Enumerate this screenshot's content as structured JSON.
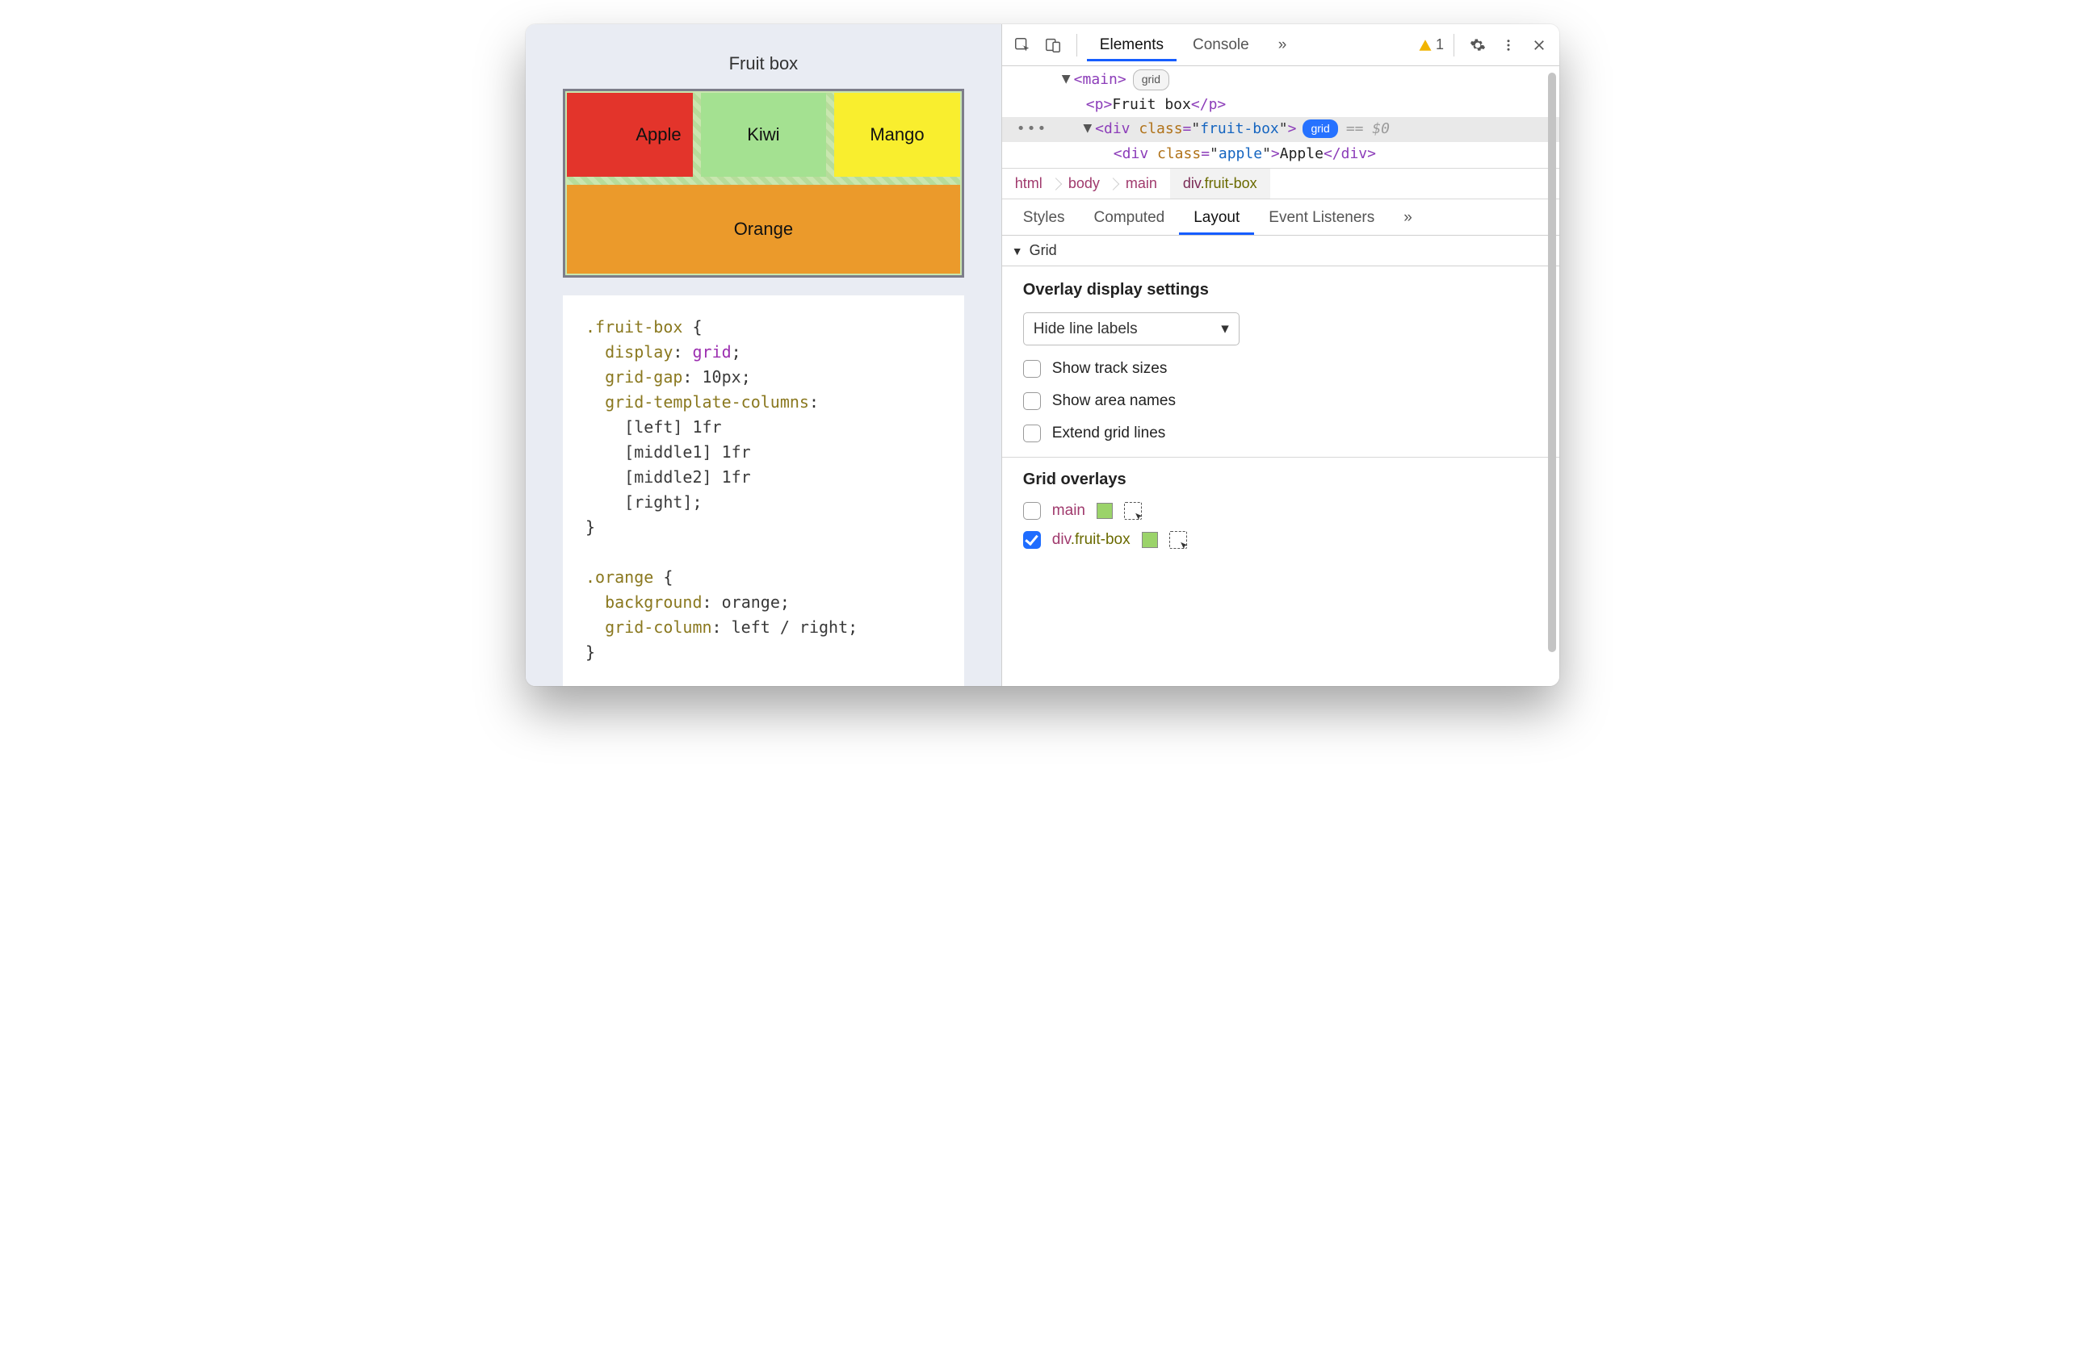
{
  "page": {
    "title": "Fruit box",
    "fruits": {
      "apple": "Apple",
      "kiwi": "Kiwi",
      "mango": "Mango",
      "orange": "Orange"
    },
    "css_block": ".fruit-box {\n  display: grid;\n  grid-gap: 10px;\n  grid-template-columns:\n    [left] 1fr\n    [middle1] 1fr\n    [middle2] 1fr\n    [right];\n}\n\n.orange {\n  background: orange;\n  grid-column: left / right;\n}"
  },
  "devtools": {
    "top_tabs": {
      "elements": "Elements",
      "console": "Console",
      "more": "»"
    },
    "warning_count": "1",
    "dom": {
      "main_open": "main",
      "grid_badge": "grid",
      "p_text": "Fruit box",
      "sel_div_attr": "class",
      "sel_div_val": "fruit-box",
      "sel_badge": "grid",
      "eq0": "== $0",
      "apple_attr": "class",
      "apple_val": "apple",
      "apple_text": "Apple"
    },
    "breadcrumbs": [
      "html",
      "body",
      "main",
      "div.fruit-box"
    ],
    "subtabs": {
      "styles": "Styles",
      "computed": "Computed",
      "layout": "Layout",
      "listeners": "Event Listeners",
      "more": "»"
    },
    "grid_panel": {
      "section_title": "Grid",
      "overlay_heading": "Overlay display settings",
      "select_value": "Hide line labels",
      "cb_track": "Show track sizes",
      "cb_area": "Show area names",
      "cb_extend": "Extend grid lines",
      "overlays_heading": "Grid overlays",
      "overlay1": "main",
      "overlay2_el": "div",
      "overlay2_cls": ".fruit-box"
    }
  }
}
